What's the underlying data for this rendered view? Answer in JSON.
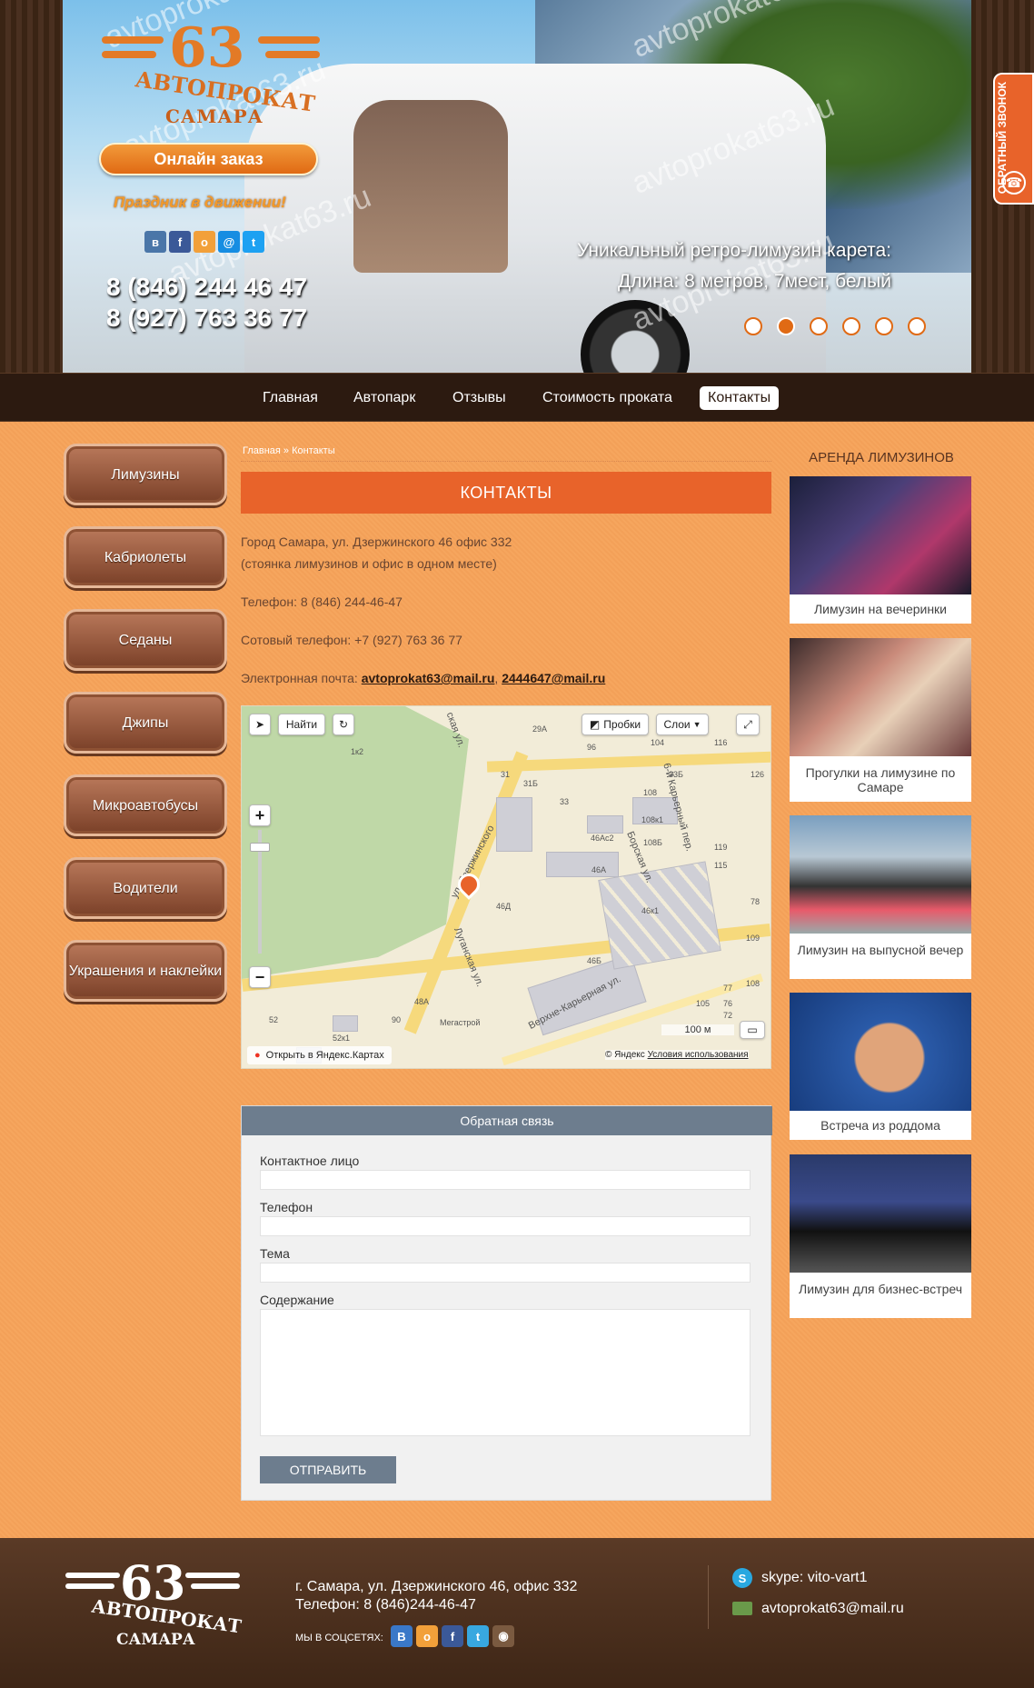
{
  "header": {
    "logo": {
      "number": "63",
      "word": "АВТОПРОКАТ",
      "city": "САМАРА"
    },
    "online_order": "Онлайн заказ",
    "slogan": "Праздник в движении!",
    "social_icons": [
      "vk-icon",
      "facebook-icon",
      "odnoklassniki-icon",
      "moimir-icon",
      "twitter-icon"
    ],
    "phones": [
      "8 (846) 244 46 47",
      "8 (927) 763 36 77"
    ],
    "watermark": "avtoprokat63.ru",
    "slide_caption": [
      "Уникальный ретро-лимузин карета:",
      "Длина: 8 метров, 7мест, белый"
    ],
    "slider_dots": 6,
    "active_dot": 2,
    "callback": "ОБРАТНЫЙ ЗВОНОК"
  },
  "nav": {
    "items": [
      {
        "label": "Главная"
      },
      {
        "label": "Автопарк"
      },
      {
        "label": "Отзывы"
      },
      {
        "label": "Стоимость проката"
      },
      {
        "label": "Контакты"
      }
    ],
    "active": "Контакты"
  },
  "sidebar": {
    "items": [
      {
        "label": "Лимузины"
      },
      {
        "label": "Кабриолеты"
      },
      {
        "label": "Седаны"
      },
      {
        "label": "Джипы"
      },
      {
        "label": "Микроавтобусы"
      },
      {
        "label": "Водители"
      },
      {
        "label": "Украшения и наклейки"
      }
    ]
  },
  "content": {
    "breadcrumb": "Главная » Контакты",
    "title": "КОНТАКТЫ",
    "address_line1": "Город Самара, ул. Дзержинского 46 офис 332",
    "address_line2": "(стоянка лимузинов и офис в одном месте)",
    "phone": "Телефон: 8 (846) 244-46-47",
    "mobile": "Сотовый телефон: +7 (927) 763 36 77",
    "email_label": "Электронная почта:",
    "email1": "avtoprokat63@mail.ru",
    "email_sep": ",",
    "email2": "2444647@mail.ru"
  },
  "map": {
    "find_button": "Найти",
    "traffic_button": "Пробки",
    "layers_button": "Слои",
    "scale": "100 м",
    "open_link": "Открыть в Яндекс.Картах",
    "copyright": "© Яндекс",
    "terms": "Условия использования",
    "street_labels": [
      "ул. Дзержинского",
      "Луганская ул.",
      "Борская ул.",
      "6-й Карьерный пер.",
      "Верхне-Карьерная ул.",
      "ская ул."
    ],
    "house_labels": [
      "46А",
      "46Б",
      "46Ас2",
      "46к1",
      "46Д",
      "108к1",
      "108Б",
      "108",
      "119",
      "115",
      "33",
      "33Б",
      "31Б",
      "31",
      "1к2",
      "29А",
      "96",
      "104",
      "116",
      "126",
      "52",
      "52к1",
      "90",
      "48А",
      "105",
      "76",
      "72",
      "77",
      "108",
      "109",
      "78"
    ],
    "poi": "Мегастрой"
  },
  "form": {
    "header": "Обратная связь",
    "fields": [
      {
        "label": "Контактное лицо"
      },
      {
        "label": "Телефон"
      },
      {
        "label": "Тема"
      },
      {
        "label": "Содержание"
      }
    ],
    "submit": "ОТПРАВИТЬ"
  },
  "right": {
    "title": "АРЕНДА ЛИМУЗИНОВ",
    "cards": [
      {
        "caption": "Лимузин на вечеринки"
      },
      {
        "caption": "Прогулки на лимузине по Самаре"
      },
      {
        "caption": "Лимузин на выпусной вечер"
      },
      {
        "caption": "Встреча из роддома"
      },
      {
        "caption": "Лимузин для бизнес-встреч"
      }
    ]
  },
  "footer": {
    "logo_number": "63",
    "logo_word": "АВТОПРОКАТ",
    "logo_city": "САМАРА",
    "address": "г. Самара, ул. Дзержинского 46, офис 332",
    "phone": "Телефон: 8 (846)244-46-47",
    "social_label": "МЫ В СОЦСЕТЯХ:",
    "skype": "skype: vito-vart1",
    "email": "avtoprokat63@mail.ru"
  },
  "colors": {
    "accent": "#e8632a",
    "brown": "#2c1a10",
    "orange_bg": "#f3a25a",
    "form_header": "#6d7d8e"
  }
}
